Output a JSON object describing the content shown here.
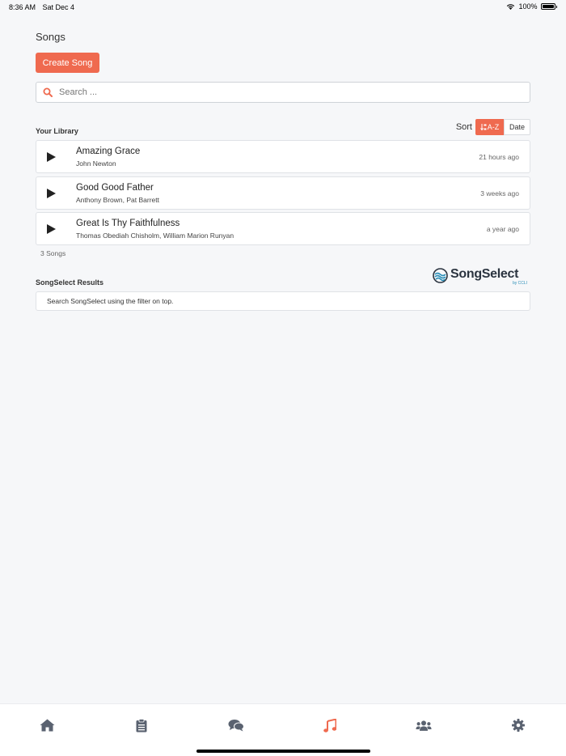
{
  "status_bar": {
    "time": "8:36 AM",
    "date": "Sat Dec 4",
    "battery": "100%"
  },
  "page": {
    "title": "Songs",
    "create_button": "Create Song"
  },
  "search": {
    "placeholder": "Search ..."
  },
  "library": {
    "label": "Your Library",
    "sort_label": "Sort",
    "sort_options": [
      "A-Z",
      "Date"
    ],
    "sort_selected": "A-Z",
    "songs": [
      {
        "title": "Amazing Grace",
        "author": "John Newton",
        "time": "21 hours ago"
      },
      {
        "title": "Good Good Father",
        "author": "Anthony Brown, Pat Barrett",
        "time": "3 weeks ago"
      },
      {
        "title": "Great Is Thy Faithfulness",
        "author": "Thomas Obediah Chisholm, William Marion Runyan",
        "time": "a year ago"
      }
    ],
    "count": "3 Songs"
  },
  "songselect": {
    "label": "SongSelect Results",
    "logo_text": "SongSelect",
    "logo_sub": "by CCLI",
    "info": "Search SongSelect using the filter on top."
  },
  "tabs": [
    {
      "icon": "home-icon",
      "active": false
    },
    {
      "icon": "clipboard-icon",
      "active": false
    },
    {
      "icon": "chat-icon",
      "active": false
    },
    {
      "icon": "music-icon",
      "active": true
    },
    {
      "icon": "users-icon",
      "active": false
    },
    {
      "icon": "gear-icon",
      "active": false
    }
  ],
  "colors": {
    "accent": "#ef6a4f",
    "inactive_icon": "#5a6270"
  }
}
